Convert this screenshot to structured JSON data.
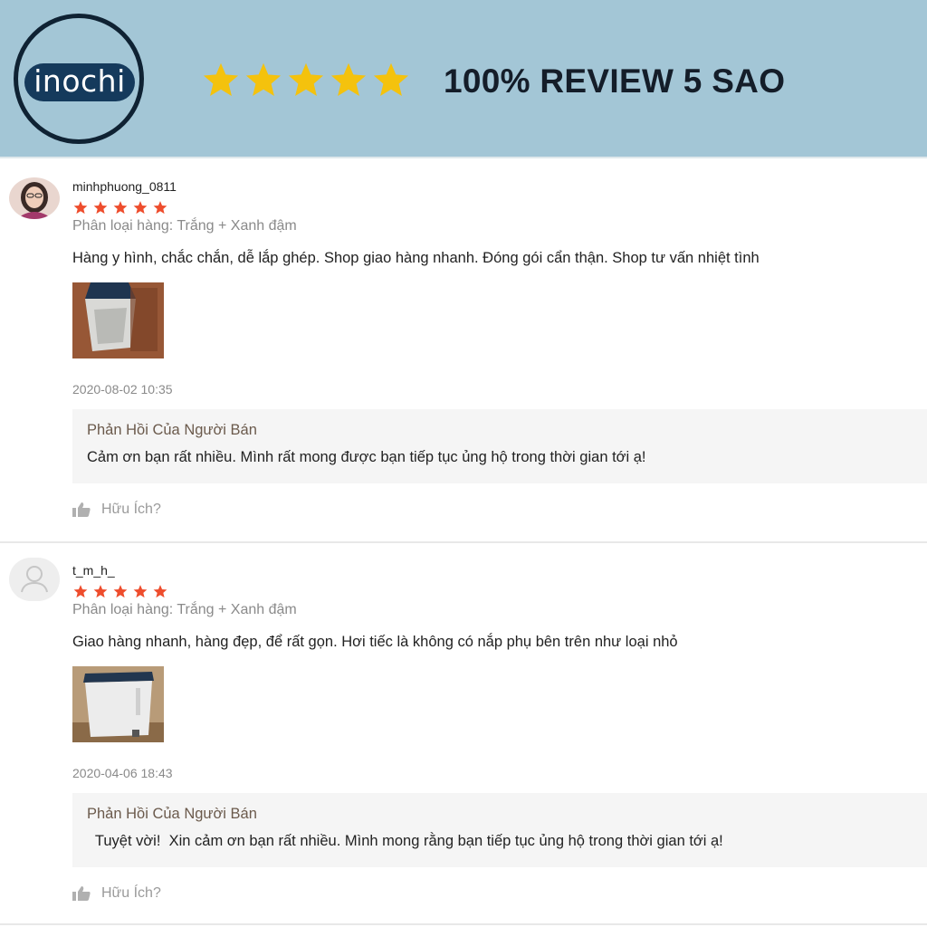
{
  "banner": {
    "logo_text": "inochi",
    "title": "100% REVIEW 5 SAO",
    "stars": 5,
    "colors": {
      "background": "#a3c6d6",
      "star": "#f4c20d",
      "logo": "#153a5c"
    }
  },
  "reviews": [
    {
      "username": "minhphuong_0811",
      "rating": 5,
      "variation": "Phân loại hàng: Trắng + Xanh đậm",
      "comment": "Hàng y hình, chắc chắn, dễ lắp ghép.  Shop giao hàng nhanh. Đóng gói cẩn thận. Shop tư vấn nhiệt tình",
      "timestamp": "2020-08-02 10:35",
      "reply_title": "Phản Hồi Của Người Bán",
      "reply_text": "Cảm ơn bạn rất nhiều. Mình rất mong được bạn tiếp tục ủng hộ trong thời gian tới ạ!",
      "helpful_label": "Hữu Ích?"
    },
    {
      "username": "t_m_h_",
      "rating": 5,
      "variation": "Phân loại hàng: Trắng + Xanh đậm",
      "comment": "Giao hàng nhanh, hàng đẹp, để rất gọn. Hơi tiếc là không có nắp phụ bên trên như loại nhỏ",
      "timestamp": "2020-04-06 18:43",
      "reply_title": "Phản Hồi Của Người Bán",
      "reply_text": "  Tuyệt vời!  Xin cảm ơn bạn rất nhiều. Mình mong rằng bạn tiếp tục ủng hộ trong thời gian tới ạ!",
      "helpful_label": "Hữu Ích?"
    }
  ],
  "icons": {
    "banner_star": "star-icon",
    "rating_star": "star-icon",
    "helpful": "thumbs-up-icon",
    "default_avatar": "user-icon"
  },
  "colors": {
    "rating_star": "#ee4d2d",
    "reply_background": "#f5f5f5"
  }
}
